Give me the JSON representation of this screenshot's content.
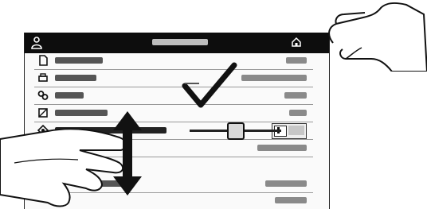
{
  "app": {
    "user_label": "",
    "title": "",
    "home_label": ""
  },
  "rows": [
    {
      "icon": "document-icon",
      "label": "",
      "value": ""
    },
    {
      "icon": "printer-icon",
      "label": "",
      "value": ""
    },
    {
      "icon": "link-icon",
      "label": "",
      "value": ""
    },
    {
      "icon": "contrast-icon",
      "label": "",
      "value": ""
    },
    {
      "icon": "settings-icon",
      "label": "",
      "value": ""
    },
    {
      "icon": "",
      "label": "",
      "value": ""
    },
    {
      "icon": "",
      "label": "",
      "value": ""
    },
    {
      "icon": "",
      "label": "",
      "value": ""
    },
    {
      "icon": "",
      "label": "",
      "value": ""
    }
  ],
  "slider": {
    "level_fraction": 0.5
  },
  "toggle": {
    "state": "on"
  },
  "overlay": {
    "gesture": "swipe-up-down",
    "confirmation": "checkmark"
  }
}
